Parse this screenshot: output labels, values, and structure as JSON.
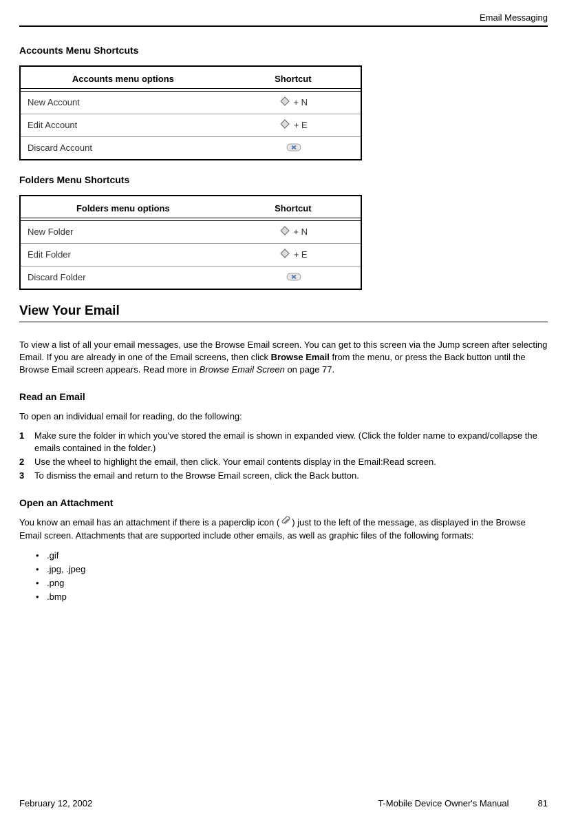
{
  "header": {
    "section": "Email Messaging"
  },
  "accounts": {
    "heading": "Accounts Menu Shortcuts",
    "col1": "Accounts menu options",
    "col2": "Shortcut",
    "rows": [
      {
        "option": "New Account",
        "shortcut": "+ N",
        "icon": "diamond"
      },
      {
        "option": "Edit Account",
        "shortcut": "+ E",
        "icon": "diamond"
      },
      {
        "option": "Discard Account",
        "shortcut": "",
        "icon": "delete"
      }
    ]
  },
  "folders": {
    "heading": "Folders Menu Shortcuts",
    "col1": "Folders menu options",
    "col2": "Shortcut",
    "rows": [
      {
        "option": "New Folder",
        "shortcut": "+ N",
        "icon": "diamond"
      },
      {
        "option": "Edit Folder",
        "shortcut": "+ E",
        "icon": "diamond"
      },
      {
        "option": "Discard Folder",
        "shortcut": "",
        "icon": "delete"
      }
    ]
  },
  "viewEmail": {
    "heading": "View Your Email",
    "body_a": "To view a list of all your email messages, use the Browse Email screen. You can get to this screen via the Jump screen after selecting Email. If you are already in one of the Email screens, then click ",
    "body_bold": "Browse Email",
    "body_b": " from the menu, or press the Back button until the Browse Email screen appears. Read more in ",
    "body_italic": "Browse Email Screen",
    "body_c": " on page 77."
  },
  "readEmail": {
    "heading": "Read an Email",
    "intro": "To open an individual email for reading, do the following:",
    "steps": [
      "Make sure the folder in which you've stored the email is shown in expanded view. (Click the folder name to expand/collapse the emails contained in the folder.)",
      "Use the wheel to highlight the email, then click. Your email contents display in the Email:Read screen.",
      "To dismiss the email and return to the Browse Email screen, click the Back button."
    ]
  },
  "attachment": {
    "heading": "Open an Attachment",
    "body_a": "You know an email has an attachment if there is a paperclip icon (",
    "body_b": ") just to the left of the message, as displayed in the Browse Email screen. Attachments that are supported include other emails, as well as graphic files of the following formats:",
    "formats": [
      ".gif",
      ".jpg, .jpeg",
      ".png",
      ".bmp"
    ]
  },
  "footer": {
    "date": "February 12, 2002",
    "manual": "T-Mobile Device Owner's Manual",
    "page": "81"
  }
}
